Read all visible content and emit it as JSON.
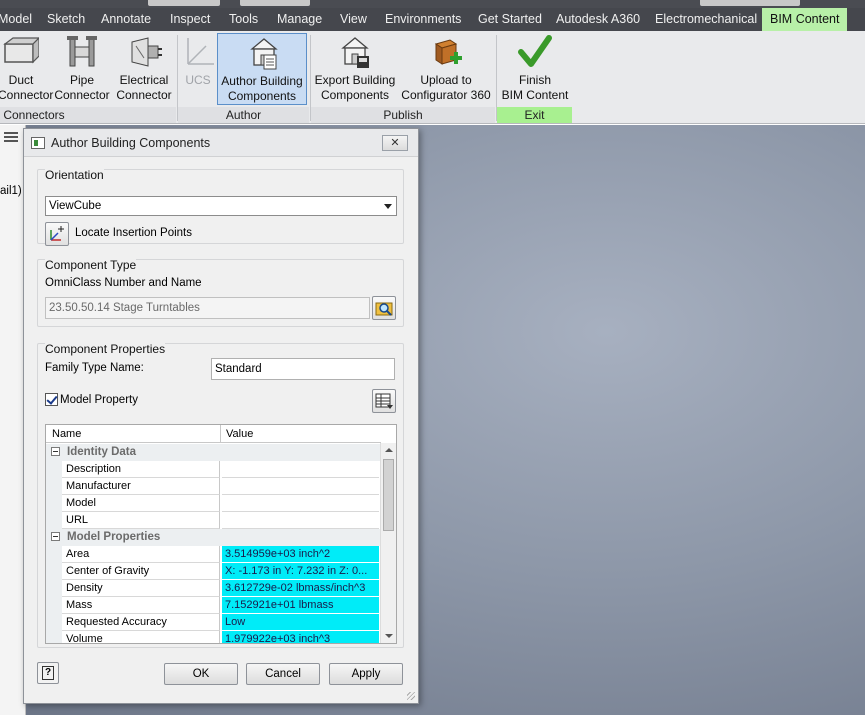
{
  "ribbon": {
    "tabs": [
      "Model",
      "Sketch",
      "Annotate",
      "Inspect",
      "Tools",
      "Manage",
      "View",
      "Environments",
      "Get Started",
      "Autodesk A360",
      "Electromechanical",
      "BIM Content"
    ],
    "buttons": {
      "duct": [
        "Duct",
        "Connector"
      ],
      "pipe": [
        "Pipe",
        "Connector"
      ],
      "electrical": [
        "Electrical",
        "Connector"
      ],
      "ucs": [
        "UCS"
      ],
      "author": [
        "Author Building",
        "Components"
      ],
      "export": [
        "Export Building",
        "Components"
      ],
      "upload": [
        "Upload to",
        "Configurator 360"
      ],
      "finish": [
        "Finish",
        "BIM Content"
      ]
    },
    "panels": {
      "connectors": "Connectors",
      "author": "Author",
      "publish": "Publish",
      "exit": "Exit"
    }
  },
  "left_pane": {
    "partial_text": "ail1)"
  },
  "dialog": {
    "title": "Author Building Components",
    "orientation": {
      "group_title": "Orientation",
      "selected": "ViewCube",
      "locate_label": "Locate Insertion Points"
    },
    "component_type": {
      "group_title": "Component Type",
      "omniclass_label": "OmniClass Number and Name",
      "omniclass_value": "23.50.50.14  Stage Turntables"
    },
    "component_properties": {
      "group_title": "Component Properties",
      "family_type_label": "Family Type Name:",
      "family_type_value": "Standard",
      "model_property_label": "Model Property",
      "grid": {
        "col_name": "Name",
        "col_value": "Value",
        "cat_identity": "Identity Data",
        "identity_rows": [
          {
            "name": "Description",
            "value": ""
          },
          {
            "name": "Manufacturer",
            "value": ""
          },
          {
            "name": "Model",
            "value": ""
          },
          {
            "name": "URL",
            "value": ""
          }
        ],
        "cat_model": "Model Properties",
        "model_rows": [
          {
            "name": "Area",
            "value": "3.514959e+03 inch^2"
          },
          {
            "name": "Center of Gravity",
            "value": "X: -1.173 in Y: 7.232 in Z: 0..."
          },
          {
            "name": "Density",
            "value": "3.612729e-02 lbmass/inch^3"
          },
          {
            "name": "Mass",
            "value": "7.152921e+01 lbmass"
          },
          {
            "name": "Requested Accuracy",
            "value": "Low"
          },
          {
            "name": "Volume",
            "value": "1.979922e+03 inch^3"
          }
        ]
      }
    },
    "buttons": {
      "ok": "OK",
      "cancel": "Cancel",
      "apply": "Apply"
    },
    "help_glyph": "?"
  },
  "colors": {
    "active_tab": "#b8f0a8",
    "exit_panel": "#a8f090",
    "highlight_value": "#00ecf8"
  }
}
